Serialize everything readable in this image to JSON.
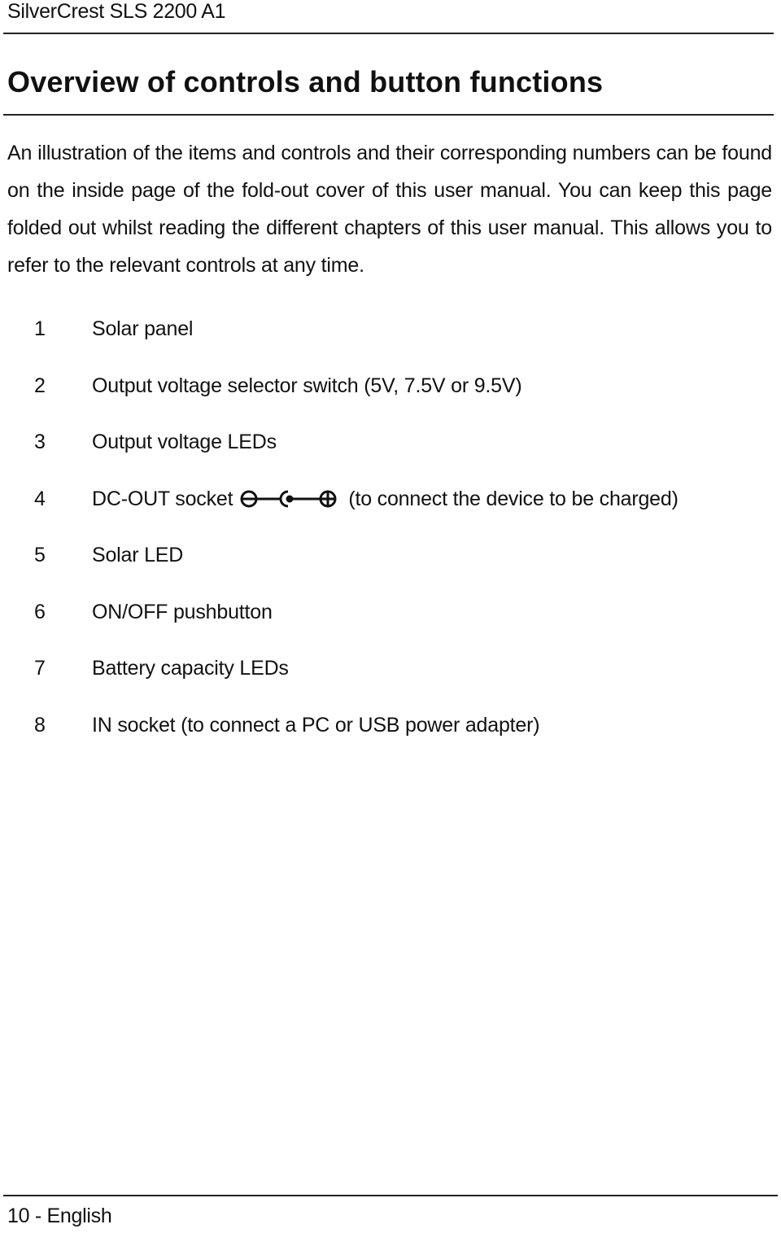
{
  "header": {
    "product": "SilverCrest SLS 2200 A1"
  },
  "title": "Overview of controls and button functions",
  "intro": "An illustration of the items and controls and their corresponding numbers can be found on the inside page of the fold-out cover of this user manual. You can keep this page folded out whilst reading the different chapters of this user manual. This allows you to refer to the relevant controls at any time.",
  "items": [
    {
      "number": "1",
      "label": "Solar panel"
    },
    {
      "number": "2",
      "label": "Output voltage selector switch (5V, 7.5V or 9.5V)"
    },
    {
      "number": "3",
      "label": "Output voltage LEDs"
    },
    {
      "number": "4",
      "label": "DC-OUT socket",
      "icon": "dc-polarity-symbol-icon",
      "suffix": "(to connect the device to be charged)"
    },
    {
      "number": "5",
      "label": "Solar LED"
    },
    {
      "number": "6",
      "label": "ON/OFF pushbutton"
    },
    {
      "number": "7",
      "label": "Battery capacity LEDs"
    },
    {
      "number": "8",
      "label": "IN socket (to connect a PC or USB power adapter)"
    }
  ],
  "footer": {
    "page_label": "10 - English"
  }
}
